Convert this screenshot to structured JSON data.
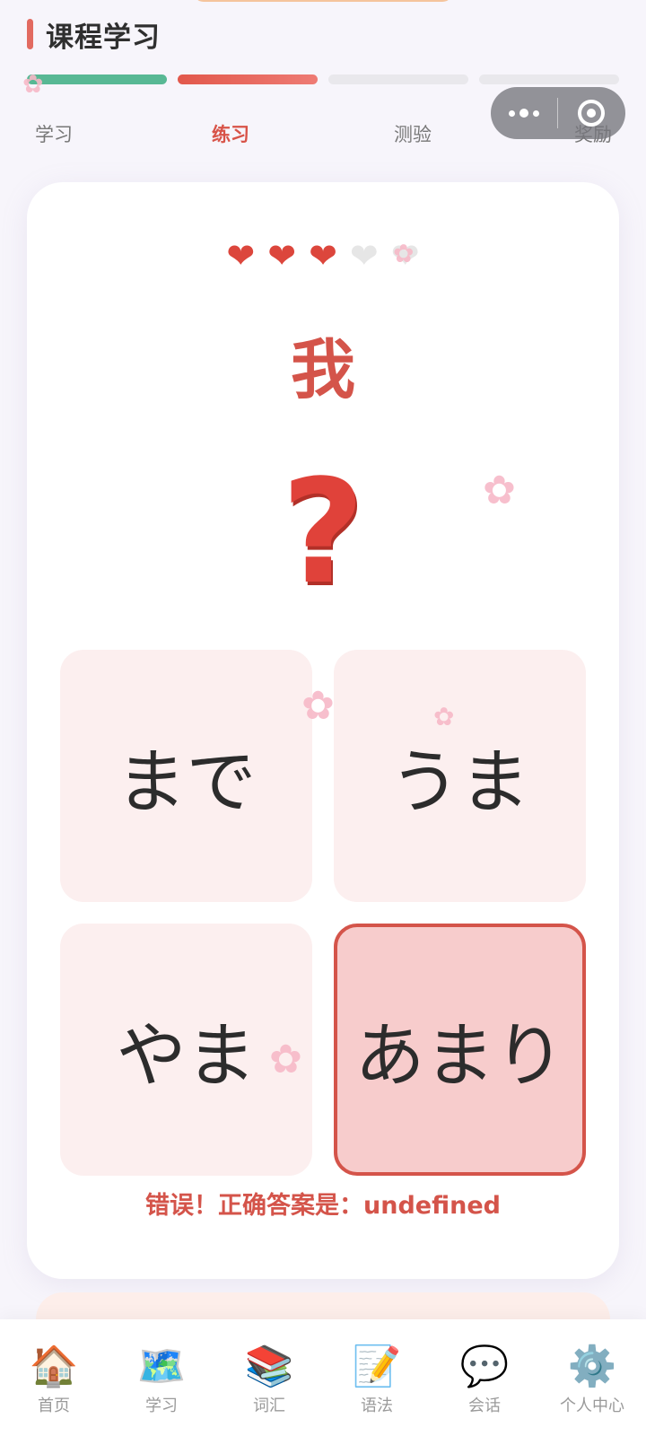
{
  "header": {
    "title": "课程学习"
  },
  "progress": {
    "segments": [
      "done",
      "active",
      "todo",
      "todo"
    ]
  },
  "steps": [
    "学习",
    "练习",
    "测验",
    "奖励"
  ],
  "lives": {
    "total": 5,
    "remaining": 3
  },
  "question": {
    "kanji": "我",
    "prompt_symbol": "?",
    "options": [
      "まで",
      "うま",
      "やま",
      "あまり"
    ],
    "selected_index": 3,
    "feedback": "错误！正确答案是：undefined"
  },
  "tabbar": [
    {
      "icon": "🏠",
      "label": "首页"
    },
    {
      "icon": "🗺️",
      "label": "学习"
    },
    {
      "icon": "📚",
      "label": "词汇"
    },
    {
      "icon": "📝",
      "label": "语法"
    },
    {
      "icon": "💬",
      "label": "会话"
    },
    {
      "icon": "⚙️",
      "label": "个人中心"
    }
  ],
  "colors": {
    "accent": "#d4544a",
    "done": "#58b894",
    "heart_on": "#dc463c",
    "heart_off": "#e6e6e6"
  }
}
